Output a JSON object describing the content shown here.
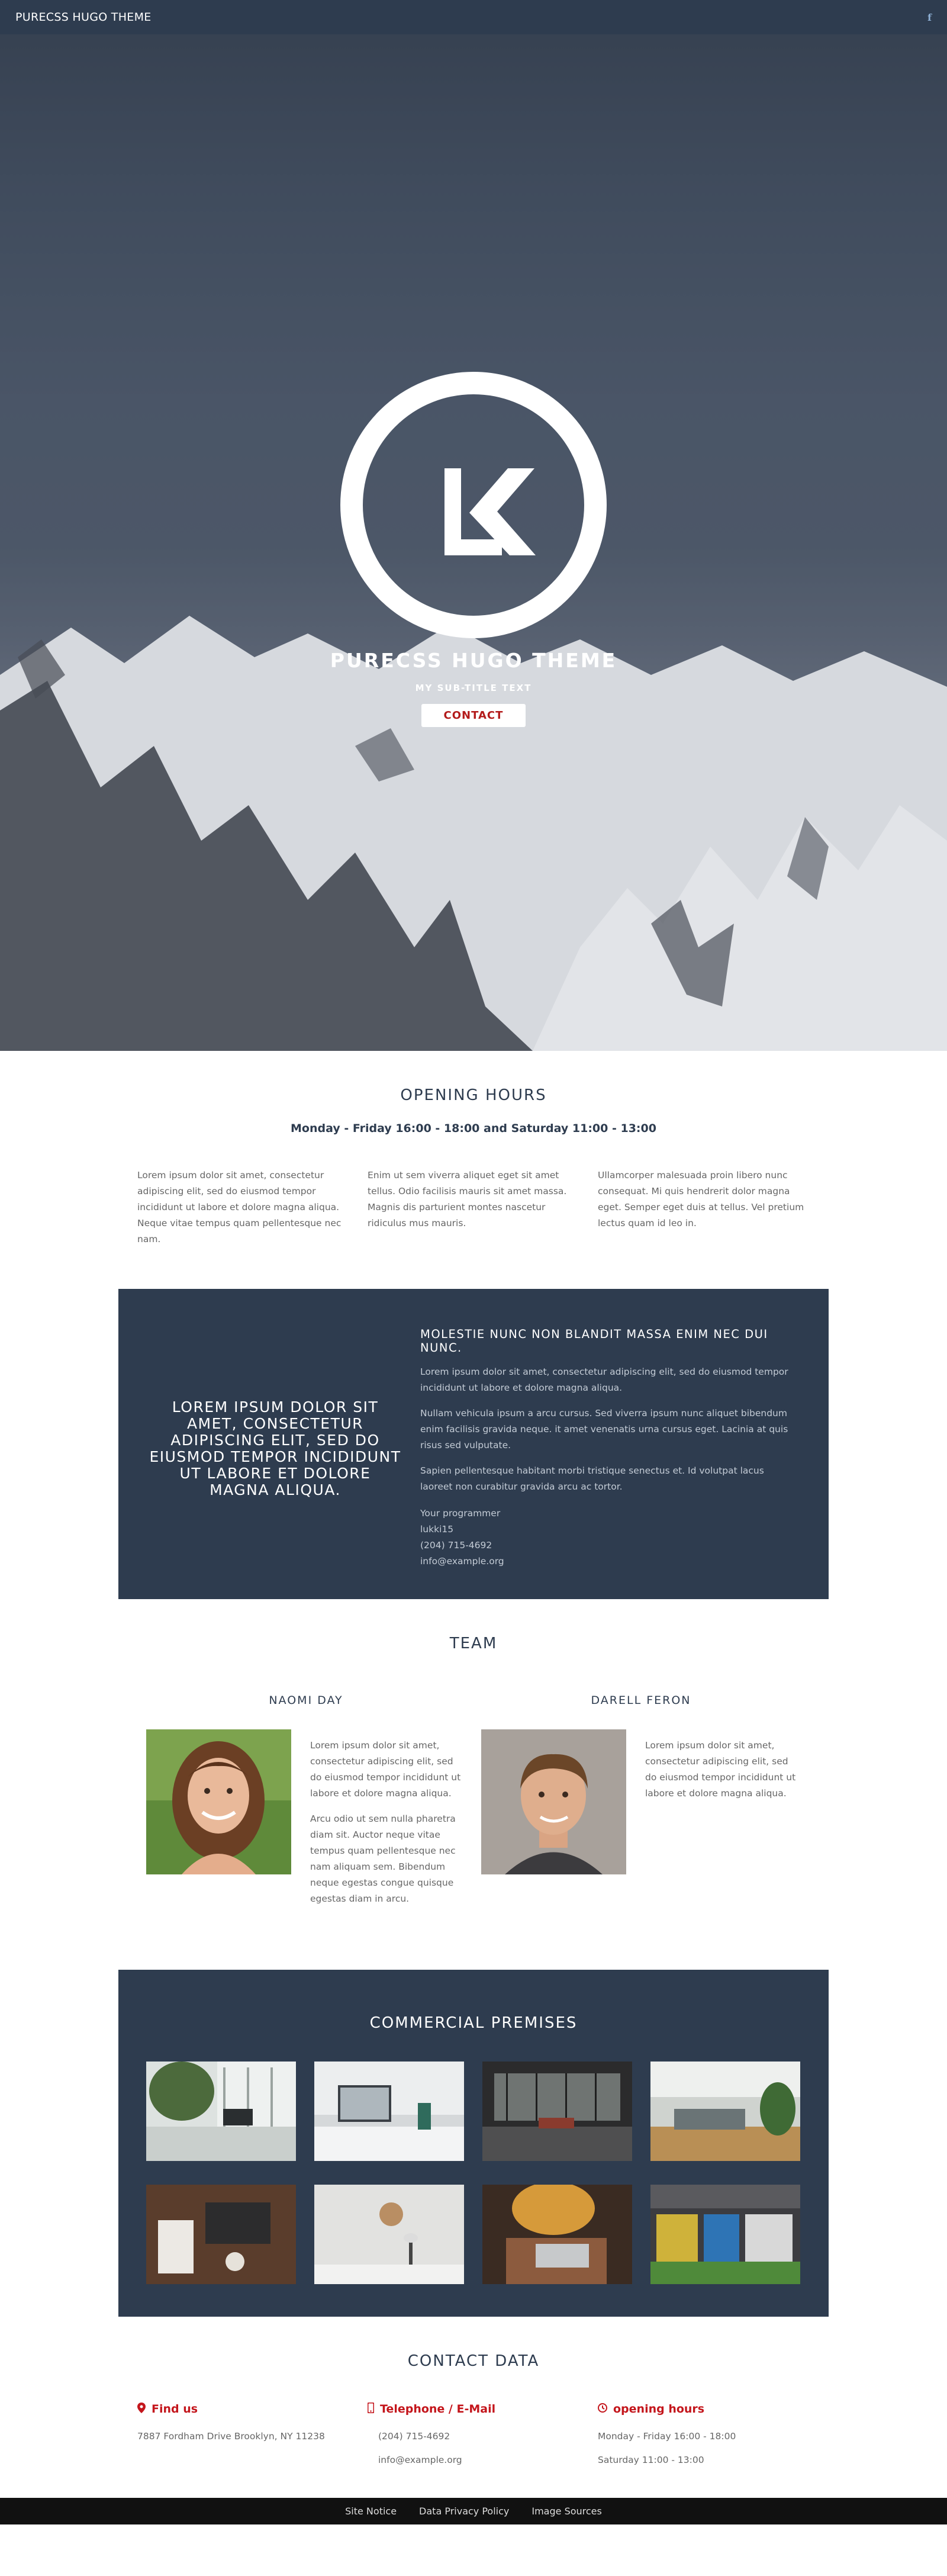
{
  "nav": {
    "brand": "PURECSS HUGO THEME",
    "social_icon": "facebook-icon",
    "social_glyph": "f"
  },
  "hero": {
    "logo_letters": "LK",
    "title": "PURECSS HUGO THEME",
    "subtitle": "MY SUB-TITLE TEXT",
    "button": "CONTACT"
  },
  "hours": {
    "title": "OPENING HOURS",
    "subtitle": "Monday - Friday 16:00 - 18:00 and Saturday 11:00 - 13:00",
    "columns": [
      "Lorem ipsum dolor sit amet, consectetur adipiscing elit, sed do eiusmod tempor incididunt ut labore et dolore magna aliqua. Neque vitae tempus quam pellentesque nec nam.",
      "Enim ut sem viverra aliquet eget sit amet tellus. Odio facilisis mauris sit amet massa. Magnis dis parturient montes nascetur ridiculus mus mauris.",
      "Ullamcorper malesuada proin libero nunc consequat. Mi quis hendrerit dolor magna eget. Semper eget duis at tellus. Vel pretium lectus quam id leo in."
    ]
  },
  "feature": {
    "left_heading": "LOREM IPSUM DOLOR SIT AMET, CONSECTETUR ADIPISCING ELIT, SED DO EIUSMOD TEMPOR INCIDIDUNT UT LABORE ET DOLORE MAGNA ALIQUA.",
    "right_heading": "MOLESTIE NUNC NON BLANDIT MASSA ENIM NEC DUI NUNC.",
    "paragraphs": [
      "Lorem ipsum dolor sit amet, consectetur adipiscing elit, sed do eiusmod tempor incididunt ut labore et dolore magna aliqua.",
      "Nullam vehicula ipsum a arcu cursus. Sed viverra ipsum nunc aliquet bibendum enim facilisis gravida neque. it amet venenatis urna cursus eget. Lacinia at quis risus sed vulputate.",
      "Sapien pellentesque habitant morbi tristique senectus et. Id volutpat lacus laoreet non curabitur gravida arcu ac tortor."
    ],
    "contact_lines": [
      "Your programmer",
      "lukki15",
      "(204) 715-4692",
      "info@example.org"
    ]
  },
  "team": {
    "title": "TEAM",
    "members": [
      {
        "name": "NAOMI DAY",
        "paragraphs": [
          "Lorem ipsum dolor sit amet, consectetur adipiscing elit, sed do eiusmod tempor incididunt ut labore et dolore magna aliqua.",
          "Arcu odio ut sem nulla pharetra diam sit. Auctor neque vitae tempus quam pellentesque nec nam aliquam sem. Bibendum neque egestas congue quisque egestas diam in arcu."
        ]
      },
      {
        "name": "DARELL FERON",
        "paragraphs": [
          "Lorem ipsum dolor sit amet, consectetur adipiscing elit, sed do eiusmod tempor incididunt ut labore et dolore magna aliqua."
        ]
      }
    ]
  },
  "premises": {
    "title": "COMMERCIAL PREMISES"
  },
  "contact": {
    "title": "CONTACT DATA",
    "find_us": {
      "heading": "Find us",
      "icon": "map-marker-icon",
      "address": "7887 Fordham Drive Brooklyn, NY 11238"
    },
    "phone": {
      "heading": "Telephone / E-Mail",
      "icon": "mobile-phone-icon",
      "phone": "(204) 715-4692",
      "email": "info@example.org"
    },
    "hours": {
      "heading": "opening hours",
      "icon": "clock-icon",
      "weekday": "Monday - Friday 16:00 - 18:00",
      "saturday": "Saturday 11:00 - 13:00"
    }
  },
  "footer": {
    "links": [
      "Site Notice",
      "Data Privacy Policy",
      "Image Sources"
    ]
  },
  "colors": {
    "navy": "#2e3c4f",
    "accent_red": "#c4161c",
    "footer": "#111111"
  }
}
